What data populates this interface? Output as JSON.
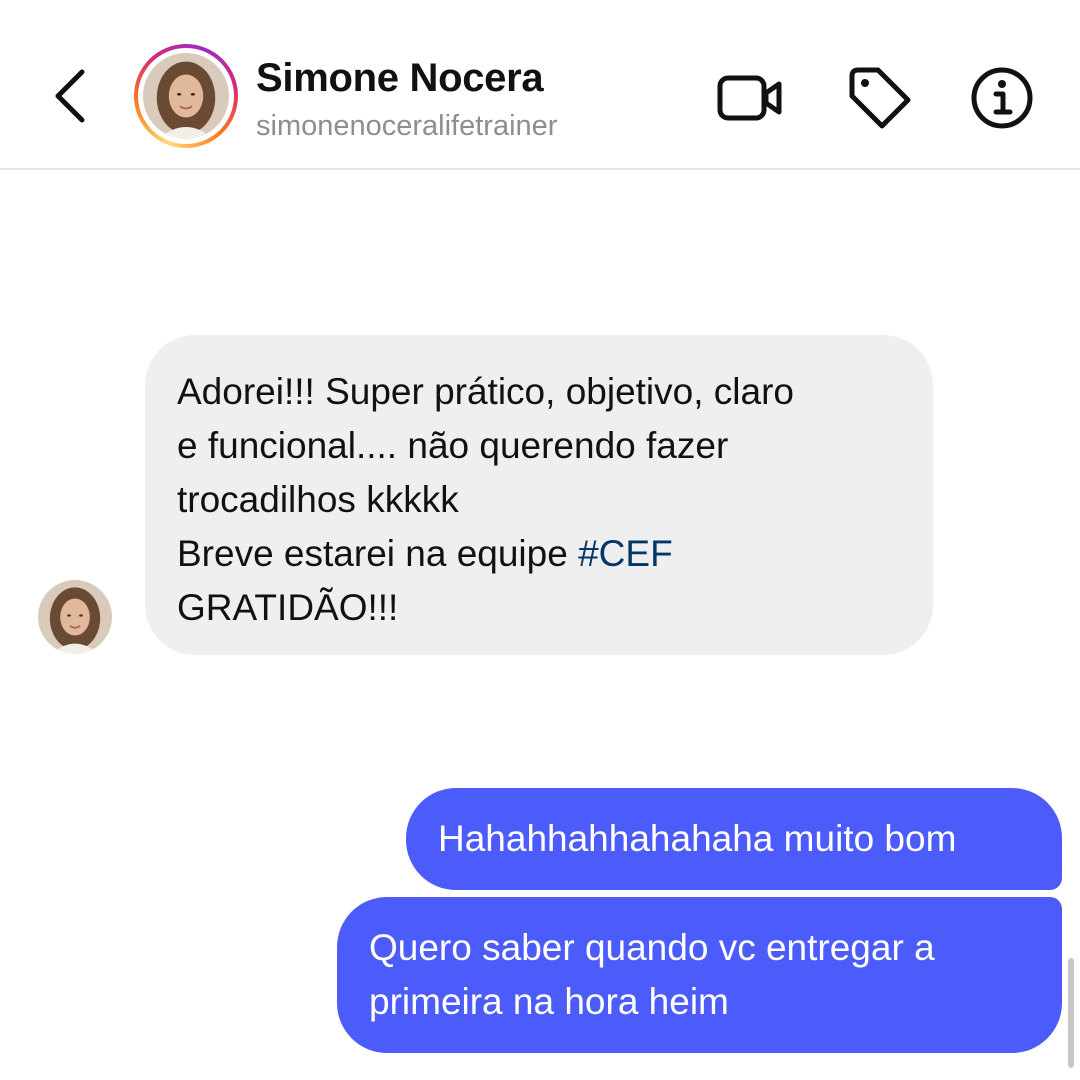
{
  "header": {
    "name": "Simone Nocera",
    "username": "simonenoceralifetrainer"
  },
  "icons": {
    "back": "chevron-left-icon",
    "video": "video-camera-icon",
    "tag": "tag-icon",
    "info": "info-icon"
  },
  "colors": {
    "outgoing_bubble": "#4c5cfb",
    "incoming_bubble": "#efefef",
    "hashtag": "#00376b",
    "story_ring": [
      "#feda75",
      "#fa7e1e",
      "#d62976",
      "#962fbf"
    ]
  },
  "messages": {
    "incoming": {
      "line1": "Adorei!!! Super prático, objetivo, claro",
      "line2": "e funcional.... não querendo fazer",
      "line3": "trocadilhos kkkkk",
      "line4_text": "Breve estarei na equipe ",
      "line4_hashtag": "#CEF",
      "line5": "GRATIDÃO!!!"
    },
    "outgoing": [
      {
        "lines": [
          "Hahahhahhahahaha muito bom"
        ]
      },
      {
        "lines": [
          "Quero saber quando vc entregar a",
          "primeira na hora heim"
        ]
      }
    ]
  }
}
